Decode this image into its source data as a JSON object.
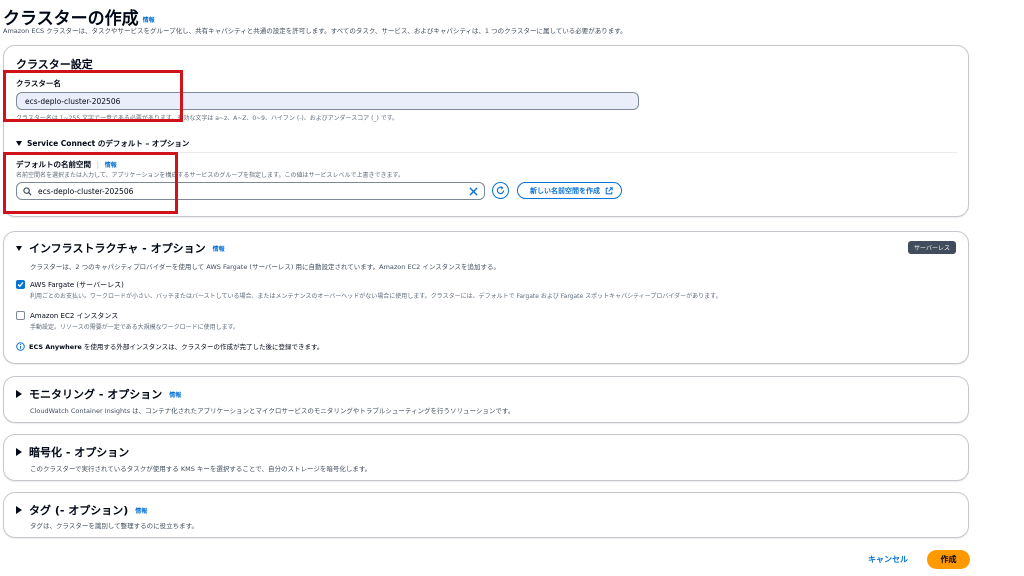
{
  "header": {
    "title": "クラスターの作成",
    "info": "情報",
    "description": "Amazon ECS クラスターは、タスクやサービスをグループ化し、共有キャパシティと共通の設定を許可します。すべてのタスク、サービス、およびキャパシティは、1 つのクラスターに属している必要があります。"
  },
  "cluster_settings": {
    "heading": "クラスター設定",
    "name_label": "クラスター名",
    "name_value": "ecs-deplo-cluster-202506",
    "name_hint": "クラスター名は 1~255 文字で一意である必要があります。有効な文字は a~z、A~Z、0~9、ハイフン (-)、およびアンダースコア (_) です。",
    "service_connect_title": "Service Connect のデフォルト – オプション",
    "namespace_label": "デフォルトの名前空間",
    "namespace_info": "情報",
    "namespace_hint": "名前空間名を選択または入力して、アプリケーションを構成するサービスのグループを指定します。この値はサービスレベルで上書きできます。",
    "namespace_value": "ecs-deplo-cluster-202506",
    "create_namespace_button": "新しい名前空間を作成"
  },
  "infrastructure": {
    "title": "インフラストラクチャ - オプション",
    "info": "情報",
    "badge": "サーバーレス",
    "description": "クラスターは、2 つのキャパシティプロバイダーを使用して AWS Fargate (サーバーレス) 用に自動設定されています。Amazon EC2 インスタンスを追加する。",
    "fargate_label": "AWS Fargate (サーバーレス)",
    "fargate_checked": true,
    "fargate_desc": "利用ごとのお支払い。ワークロードが小さい、バッチまたはバーストしている場合、またはメンテナンスのオーバーヘッドがない場合に使用します。クラスターには、デフォルトで Fargate および Fargate スポットキャパシティープロバイダーがあります。",
    "ec2_label": "Amazon EC2 インスタンス",
    "ec2_checked": false,
    "ec2_desc": "手動設定。リソースの需要が一定である大規模なワークロードに使用します。",
    "anywhere_bold": "ECS Anywhere",
    "anywhere_text": " を使用する外部インスタンスは、クラスターの作成が完了した後に登録できます。"
  },
  "monitoring": {
    "title": "モニタリング - オプション",
    "info": "情報",
    "description": "CloudWatch Container Insights は、コンテナ化されたアプリケーションとマイクロサービスのモニタリングやトラブルシューティングを行うソリューションです。"
  },
  "encryption": {
    "title": "暗号化 - オプション",
    "description": "このクラスターで実行されているタスクが使用する KMS キーを選択することで、自分のストレージを暗号化します。"
  },
  "tags": {
    "title": "タグ (- オプション)",
    "info": "情報",
    "description": "タグは、クラスターを識別して整理するのに役立ちます。"
  },
  "footer": {
    "cancel": "キャンセル",
    "create": "作成"
  },
  "colors": {
    "link": "#0972d3",
    "primary": "#ff9900",
    "annotation": "#d0121a"
  }
}
